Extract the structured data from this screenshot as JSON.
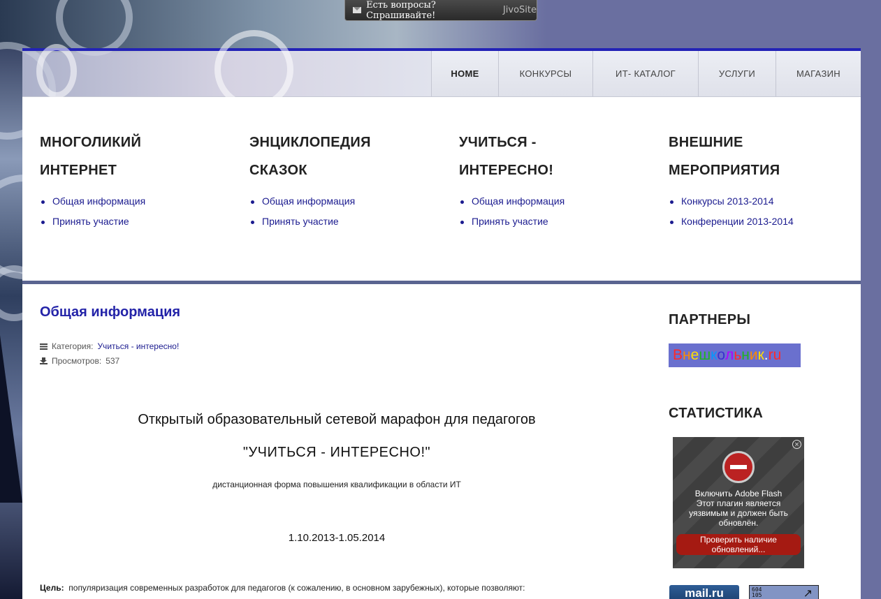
{
  "chat_widget": {
    "text": "Есть вопросы? Спрашивайте!",
    "brand": "JivoSite"
  },
  "nav": {
    "items": [
      {
        "label": "HOME",
        "active": true
      },
      {
        "label": "КОНКУРСЫ",
        "active": false
      },
      {
        "label": "ИТ- КАТАЛОГ",
        "active": false
      },
      {
        "label": "УСЛУГИ",
        "active": false
      },
      {
        "label": "МАГАЗИН",
        "active": false
      }
    ]
  },
  "menu": {
    "columns": [
      {
        "title_line1": "МНОГОЛИКИЙ",
        "title_line2": "ИНТЕРНЕТ",
        "links": [
          "Общая информация",
          "Принять участие"
        ]
      },
      {
        "title_line1": "ЭНЦИКЛОПЕДИЯ",
        "title_line2": "СКАЗОК",
        "links": [
          "Общая информация",
          "Принять участие"
        ]
      },
      {
        "title_line1": "УЧИТЬСЯ -",
        "title_line2": "ИНТЕРЕСНО!",
        "links": [
          "Общая информация",
          "Принять участие"
        ]
      },
      {
        "title_line1": "ВНЕШНИЕ",
        "title_line2": "МЕРОПРИЯТИЯ",
        "links": [
          "Конкурсы 2013-2014",
          "Конференции 2013-2014"
        ]
      }
    ]
  },
  "article": {
    "title": "Общая информация",
    "category_label": "Категория:",
    "category_value": "Учиться - интересно!",
    "views_label": "Просмотров:",
    "views_value": "537",
    "headline": "Открытый образовательный сетевой марафон для педагогов",
    "subheadline": "\"УЧИТЬСЯ - ИНТЕРЕСНО!\"",
    "description": "дистанционная форма повышения квалификации в области ИТ",
    "dates": "1.10.2013-1.05.2014",
    "goal_label": "Цель:",
    "goal_text": "популяризация современных разработок для педагогов (к сожалению, в основном зарубежных), которые позволяют:"
  },
  "sidebar": {
    "partners_title": "ПАРТНЕРЫ",
    "partner_logo_text": "Внешкольник.ru",
    "partner_logo_colors": [
      "#ff2a2a",
      "#ff8a00",
      "#ffe000",
      "#1fb51f",
      "#0099ff",
      "#3a2fd0",
      "#b000ff",
      "#ff2a2a",
      "#1fb51f",
      "#ff8a00",
      "#ffe000",
      "#ffffff",
      "#ff2a2a",
      "#ff2a2a"
    ],
    "stats_title": "СТАТИСТИКА",
    "flash_line1": "Включить Adobe Flash",
    "flash_line2": "Этот плагин является",
    "flash_line3": "уязвимым и должен быть",
    "flash_line4": "обновлён.",
    "flash_button": "Проверить наличие обновлений...",
    "mailru_label": "mail.ru",
    "counter_line1": "604",
    "counter_line2": "105"
  }
}
